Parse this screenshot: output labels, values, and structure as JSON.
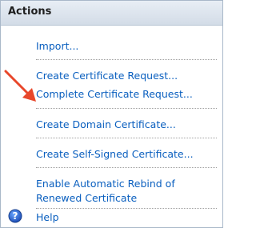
{
  "header": {
    "title": "Actions"
  },
  "actions": [
    {
      "label": "Import..."
    },
    {
      "label": "Create Certificate Request..."
    },
    {
      "label": "Complete Certificate Request..."
    },
    {
      "label": "Create Domain Certificate..."
    },
    {
      "label": "Create Self-Signed Certificate..."
    },
    {
      "label": "Enable Automatic Rebind of"
    },
    {
      "label": "Renewed Certificate"
    }
  ],
  "help": {
    "label": "Help",
    "icon": "help-icon"
  },
  "colors": {
    "link": "#0a5fbf",
    "arrow": "#e8472b",
    "help": "#1f66c9"
  }
}
